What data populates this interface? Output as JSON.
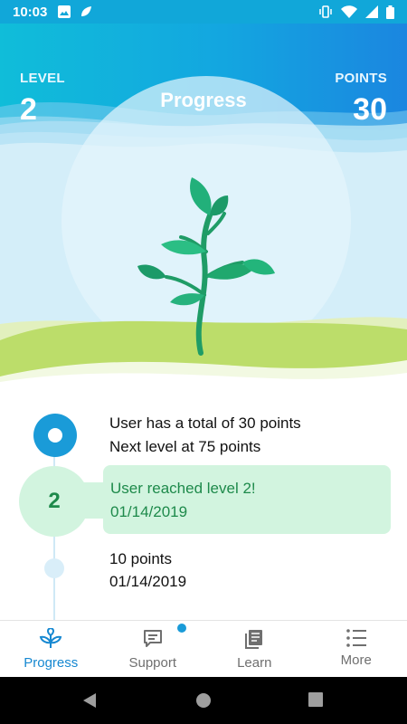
{
  "status_bar": {
    "time": "10:03"
  },
  "header": {
    "level_label": "LEVEL",
    "level_value": "2",
    "title": "Progress",
    "points_label": "POINTS",
    "points_value": "30"
  },
  "timeline": {
    "summary_line1": "User has a total of 30 points",
    "summary_line2": "Next level at 75 points",
    "level_badge": "2",
    "level_event_title": "User reached level 2!",
    "level_event_date": "01/14/2019",
    "points_event_title": "10 points",
    "points_event_date": "01/14/2019"
  },
  "bottom_nav": {
    "items": [
      {
        "label": "Progress",
        "icon": "sprout-icon",
        "active": true
      },
      {
        "label": "Support",
        "icon": "chat-icon",
        "badge": true
      },
      {
        "label": "Learn",
        "icon": "book-icon"
      },
      {
        "label": "More",
        "icon": "menu-list-icon"
      }
    ]
  },
  "colors": {
    "header_gradient_start": "#10BDD9",
    "header_gradient_end": "#1B86E0",
    "plant_green": "#20A86E",
    "grass_green": "#BCDD6A",
    "accent_blue": "#1688D1",
    "card_green": "#D2F4DF",
    "card_text_green": "#1E8A4B"
  }
}
